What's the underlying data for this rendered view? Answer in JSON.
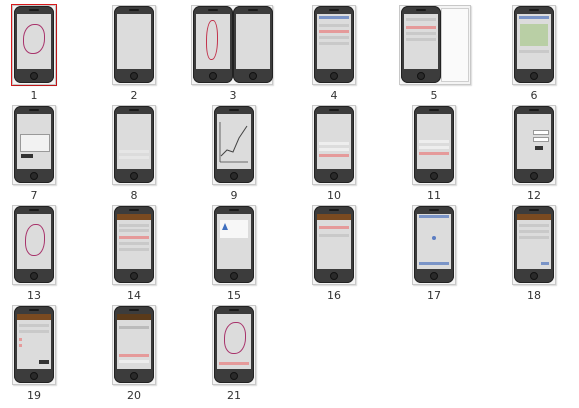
{
  "thumbnails": [
    {
      "label": "1",
      "selected": true
    },
    {
      "label": "2"
    },
    {
      "label": "3"
    },
    {
      "label": "4"
    },
    {
      "label": "5"
    },
    {
      "label": "6"
    },
    {
      "label": "7"
    },
    {
      "label": "8"
    },
    {
      "label": "9"
    },
    {
      "label": "10"
    },
    {
      "label": "11"
    },
    {
      "label": "12"
    },
    {
      "label": "13"
    },
    {
      "label": "14"
    },
    {
      "label": "15"
    },
    {
      "label": "16"
    },
    {
      "label": "17"
    },
    {
      "label": "18"
    },
    {
      "label": "19"
    },
    {
      "label": "20"
    },
    {
      "label": "21"
    }
  ],
  "colors": {
    "selection": "#d8191b",
    "phone_body": "#3c3c3c",
    "route": "#a8336b",
    "header_brown": "#7a4a20"
  }
}
